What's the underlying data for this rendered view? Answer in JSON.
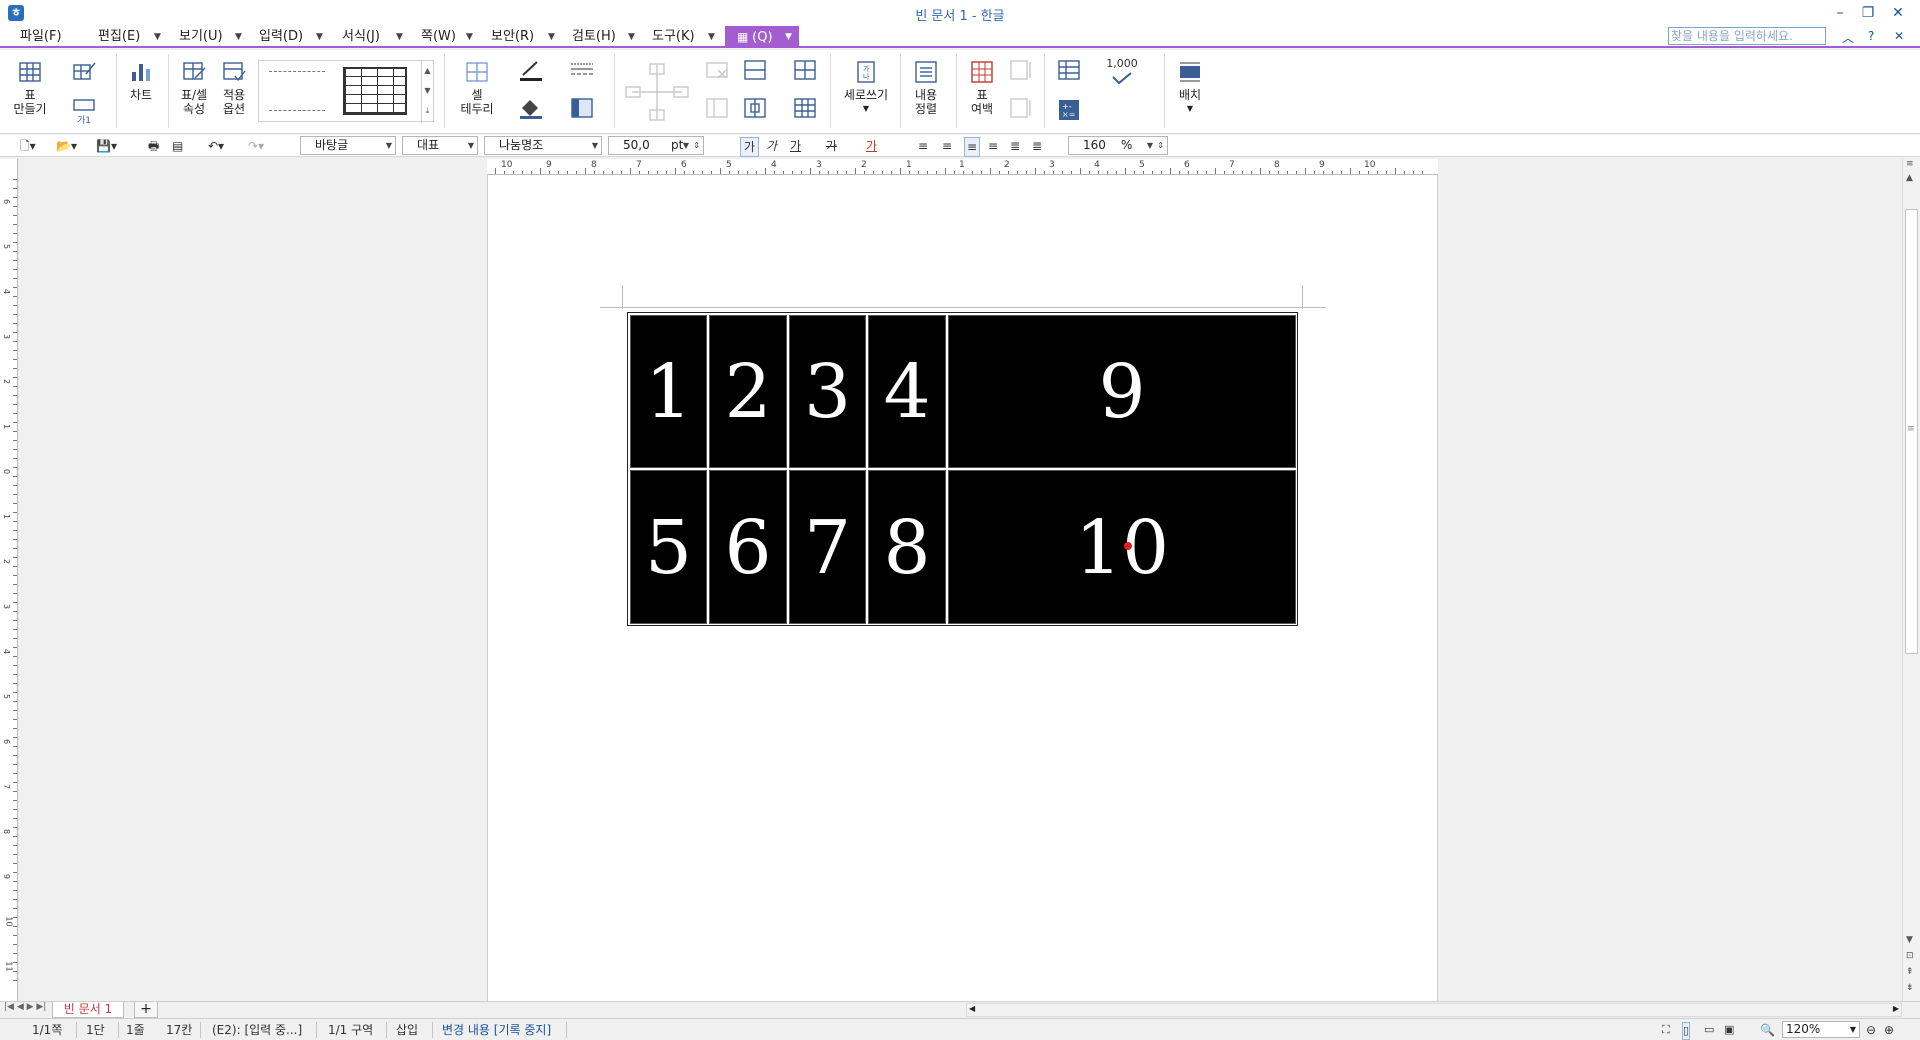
{
  "window": {
    "title": "빈 문서 1 - 한글",
    "app_icon": "hwp-app-icon",
    "minimize": "–",
    "restore": "❐",
    "close": "✕"
  },
  "menu": {
    "items": [
      "파일(F)",
      "편집(E)",
      "보기(U)",
      "입력(D)",
      "서식(J)",
      "쪽(W)",
      "보안(R)",
      "검토(H)",
      "도구(K)"
    ],
    "active_tab": "(Q)",
    "search_placeholder": "찾을 내용을 입력하세요.",
    "collapse": "︿",
    "help": "?",
    "close_doc": "✕"
  },
  "ribbon": {
    "make_table": "표\n만들기",
    "chart": "차트",
    "table_cell_props": "표/셀\n속성",
    "apply_options": "적용\n옵션",
    "cell_border": "셀\n테두리",
    "vertical_write": "세로쓰기",
    "content_align": "내용\n정렬",
    "table_margin": "표\n여백",
    "number_format": "1,000",
    "arrange": "배치",
    "cell_style_sample": "가1"
  },
  "format_bar": {
    "style": "바탕글",
    "lang": "대표",
    "font": "나눔명조",
    "size": "50,0",
    "size_unit": "pt",
    "bold": "가",
    "italic": "가",
    "underline": "가",
    "strike": "가",
    "color": "가",
    "line_spacing": "160",
    "line_spacing_unit": "%"
  },
  "ruler": {
    "h_labels": [
      "10",
      "9",
      "8",
      "7",
      "6",
      "5",
      "4",
      "3",
      "2",
      "1",
      "1",
      "2",
      "3",
      "4",
      "5",
      "6",
      "7",
      "8",
      "9",
      "10"
    ],
    "v_labels": [
      "6",
      "5",
      "4",
      "3",
      "2",
      "1",
      "0",
      "1",
      "2",
      "3",
      "4",
      "5",
      "6",
      "7",
      "8",
      "9",
      "10",
      "11"
    ]
  },
  "document": {
    "table": {
      "rows": [
        [
          "1",
          "2",
          "3",
          "4",
          "9"
        ],
        [
          "5",
          "6",
          "7",
          "8",
          "10"
        ]
      ],
      "cell_bg": "#000000",
      "cell_fg": "#ffffff"
    }
  },
  "tabs": {
    "doc_tab": "빈 문서 1",
    "add": "+"
  },
  "status": {
    "page": "1/1쪽",
    "column": "1단",
    "line": "1줄",
    "col_pos": "17칸",
    "cell_info": "(E2): [입력 중...]",
    "section": "1/1 구역",
    "insert_mode": "삽입",
    "track_changes": "변경 내용 [기록 중지]",
    "zoom": "120%"
  },
  "colors": {
    "accent": "#a45dd0",
    "title_blue": "#3a66b5",
    "track_changes_blue": "#1a53a0"
  }
}
